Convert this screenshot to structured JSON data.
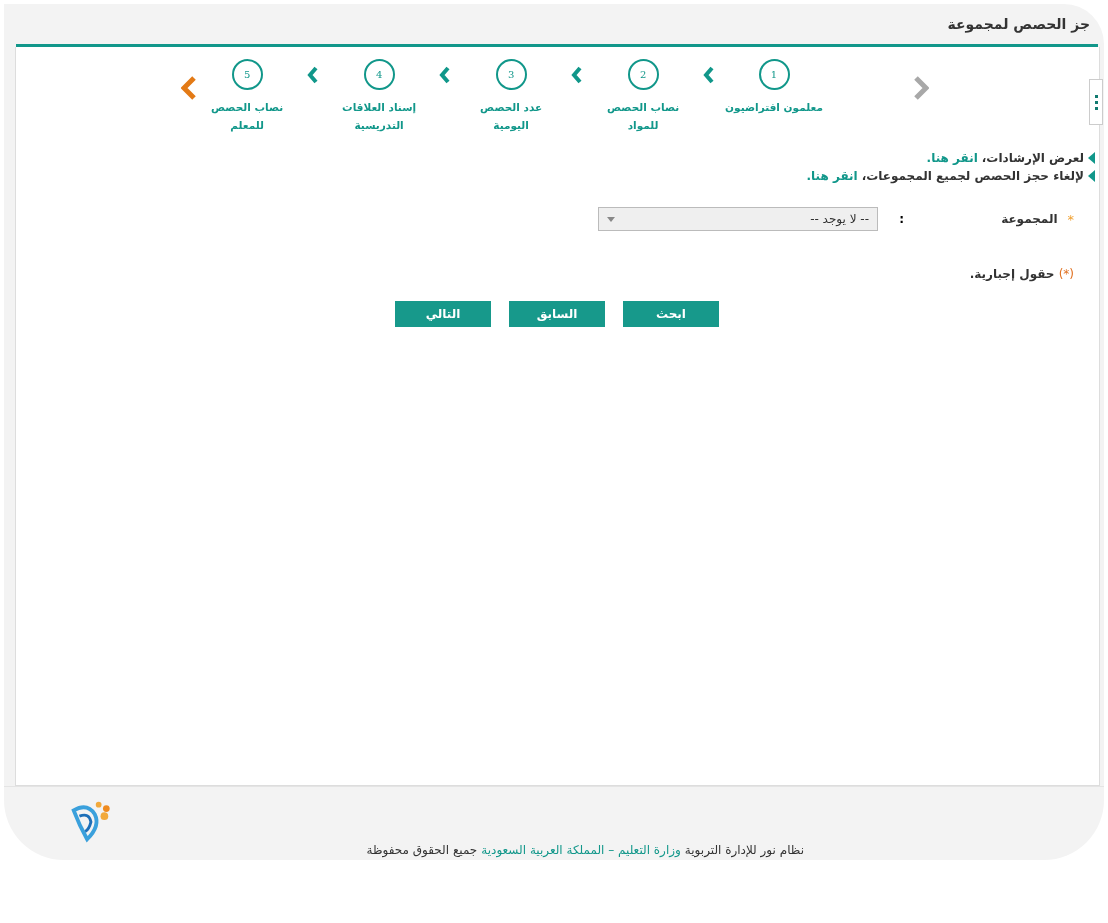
{
  "page_title": "جز الحصص لمجموعة",
  "wizard": {
    "previous_disabled": true,
    "next_disabled": false,
    "steps": [
      {
        "number": "1",
        "label": "معلمون افتراضيون"
      },
      {
        "number": "2",
        "label": "نصاب الحصص للمواد"
      },
      {
        "number": "3",
        "label": "عدد الحصص اليومية"
      },
      {
        "number": "4",
        "label": "إسناد العلاقات التدريسية"
      },
      {
        "number": "5",
        "label": "نصاب الحصص للمعلم"
      }
    ]
  },
  "instructions": [
    {
      "text": "لعرض الإرشادات،",
      "link": "انقر هنا."
    },
    {
      "text": "لإلغاء حجز الحصص لجميع المجموعات،",
      "link": "انقر هنا."
    }
  ],
  "form": {
    "fields": [
      {
        "label": "المجموعة",
        "required_mark": "*",
        "separator": ":",
        "value": "-- لا يوجد --"
      }
    ],
    "required_note": {
      "mark": "(*)",
      "text": "حقول إجبارية."
    }
  },
  "buttons": [
    "ابحث",
    "السابق",
    "التالي"
  ],
  "footer": {
    "parts": [
      {
        "text": "نظام نور للإدارة التربوية",
        "highlight": false
      },
      {
        "text": "وزارة التعليم – المملكة العربية السعودية",
        "highlight": true
      },
      {
        "text": "جميع الحقوق محفوظة",
        "highlight": false
      }
    ]
  }
}
